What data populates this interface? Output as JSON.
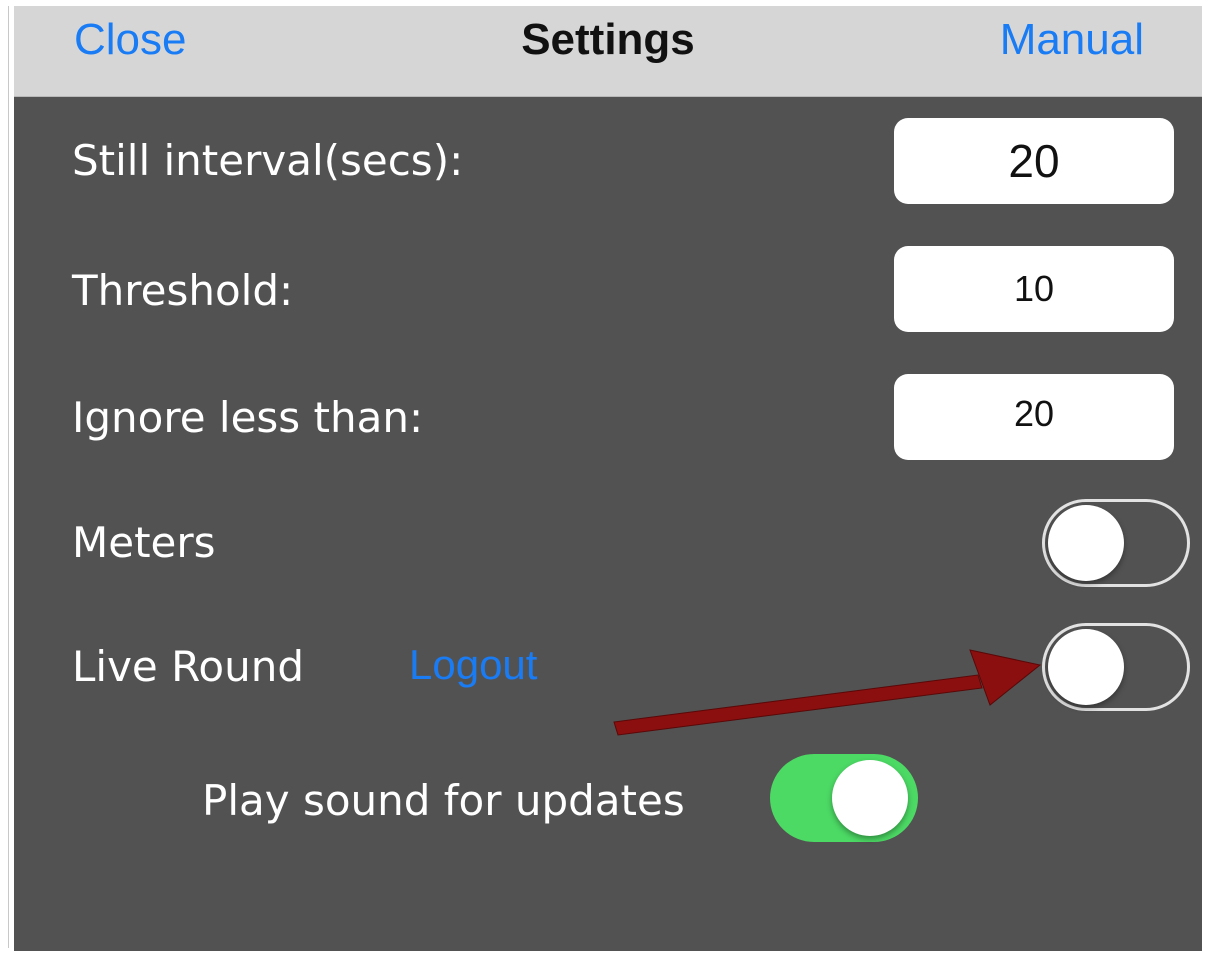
{
  "navbar": {
    "close_label": "Close",
    "title": "Settings",
    "manual_label": "Manual"
  },
  "settings": {
    "still_interval": {
      "label": "Still interval(secs):",
      "value": "20"
    },
    "threshold": {
      "label": "Threshold:",
      "value": "10"
    },
    "ignore_less_than": {
      "label": "Ignore less than:",
      "value": "20"
    },
    "meters": {
      "label": "Meters",
      "on": false
    },
    "live_round": {
      "label": "Live Round",
      "on": false,
      "logout_label": "Logout"
    },
    "play_sound": {
      "label": "Play sound for updates",
      "on": true
    }
  },
  "colors": {
    "link": "#1a7cf5",
    "panel_bg": "#525252",
    "navbar_bg": "#d6d6d6",
    "toggle_on": "#4cd964",
    "annotation_arrow": "#8b0f0f"
  },
  "annotation": {
    "type": "arrow",
    "target": "live-round-toggle"
  }
}
